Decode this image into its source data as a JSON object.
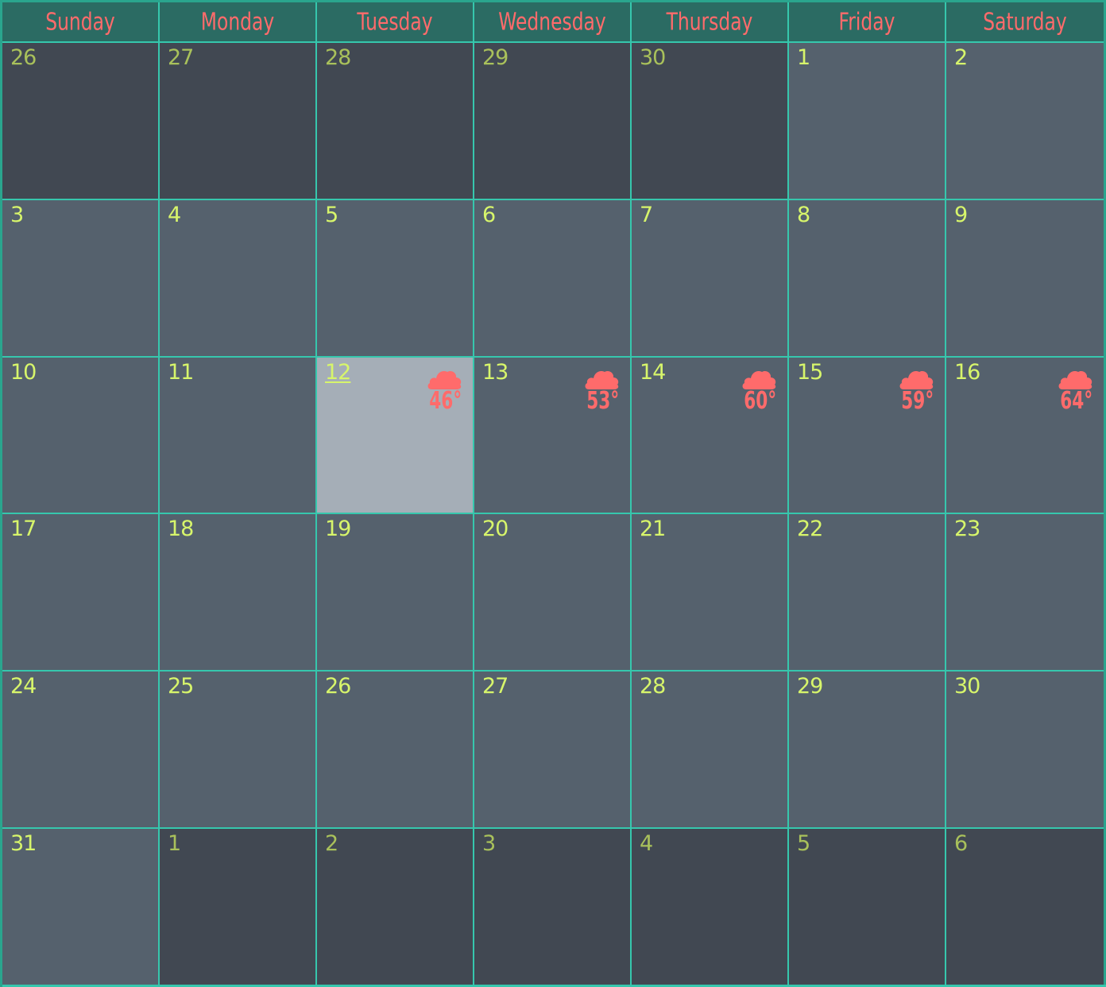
{
  "calendar": {
    "weekdays": [
      "Sunday",
      "Monday",
      "Tuesday",
      "Wednesday",
      "Thursday",
      "Friday",
      "Saturday"
    ],
    "weeks": [
      [
        {
          "day": "26",
          "other": true
        },
        {
          "day": "27",
          "other": true
        },
        {
          "day": "28",
          "other": true
        },
        {
          "day": "29",
          "other": true
        },
        {
          "day": "30",
          "other": true
        },
        {
          "day": "1",
          "other": false
        },
        {
          "day": "2",
          "other": false
        }
      ],
      [
        {
          "day": "3",
          "other": false
        },
        {
          "day": "4",
          "other": false
        },
        {
          "day": "5",
          "other": false
        },
        {
          "day": "6",
          "other": false
        },
        {
          "day": "7",
          "other": false
        },
        {
          "day": "8",
          "other": false
        },
        {
          "day": "9",
          "other": false
        }
      ],
      [
        {
          "day": "10",
          "other": false
        },
        {
          "day": "11",
          "other": false
        },
        {
          "day": "12",
          "other": false,
          "today": true,
          "temp": "46°",
          "icon": "cloud-icon"
        },
        {
          "day": "13",
          "other": false,
          "temp": "53°",
          "icon": "cloud-icon"
        },
        {
          "day": "14",
          "other": false,
          "temp": "60°",
          "icon": "cloud-icon"
        },
        {
          "day": "15",
          "other": false,
          "temp": "59°",
          "icon": "cloud-icon"
        },
        {
          "day": "16",
          "other": false,
          "temp": "64°",
          "icon": "cloud-icon"
        }
      ],
      [
        {
          "day": "17",
          "other": false
        },
        {
          "day": "18",
          "other": false
        },
        {
          "day": "19",
          "other": false
        },
        {
          "day": "20",
          "other": false
        },
        {
          "day": "21",
          "other": false
        },
        {
          "day": "22",
          "other": false
        },
        {
          "day": "23",
          "other": false
        }
      ],
      [
        {
          "day": "24",
          "other": false
        },
        {
          "day": "25",
          "other": false
        },
        {
          "day": "26",
          "other": false
        },
        {
          "day": "27",
          "other": false
        },
        {
          "day": "28",
          "other": false
        },
        {
          "day": "29",
          "other": false
        },
        {
          "day": "30",
          "other": false
        }
      ],
      [
        {
          "day": "31",
          "other": false
        },
        {
          "day": "1",
          "other": true
        },
        {
          "day": "2",
          "other": true
        },
        {
          "day": "3",
          "other": true
        },
        {
          "day": "4",
          "other": true
        },
        {
          "day": "5",
          "other": true
        },
        {
          "day": "6",
          "other": true
        }
      ]
    ]
  },
  "colors": {
    "header_bg": "#2b6b63",
    "grid_line": "#36c7ad",
    "weekday_text": "#ff6b6b",
    "day_text": "#d7f56b",
    "cell_current": "#55616d",
    "cell_other": "#414852",
    "cell_today": "#a5aeb7",
    "weather": "#ff6b6b"
  }
}
